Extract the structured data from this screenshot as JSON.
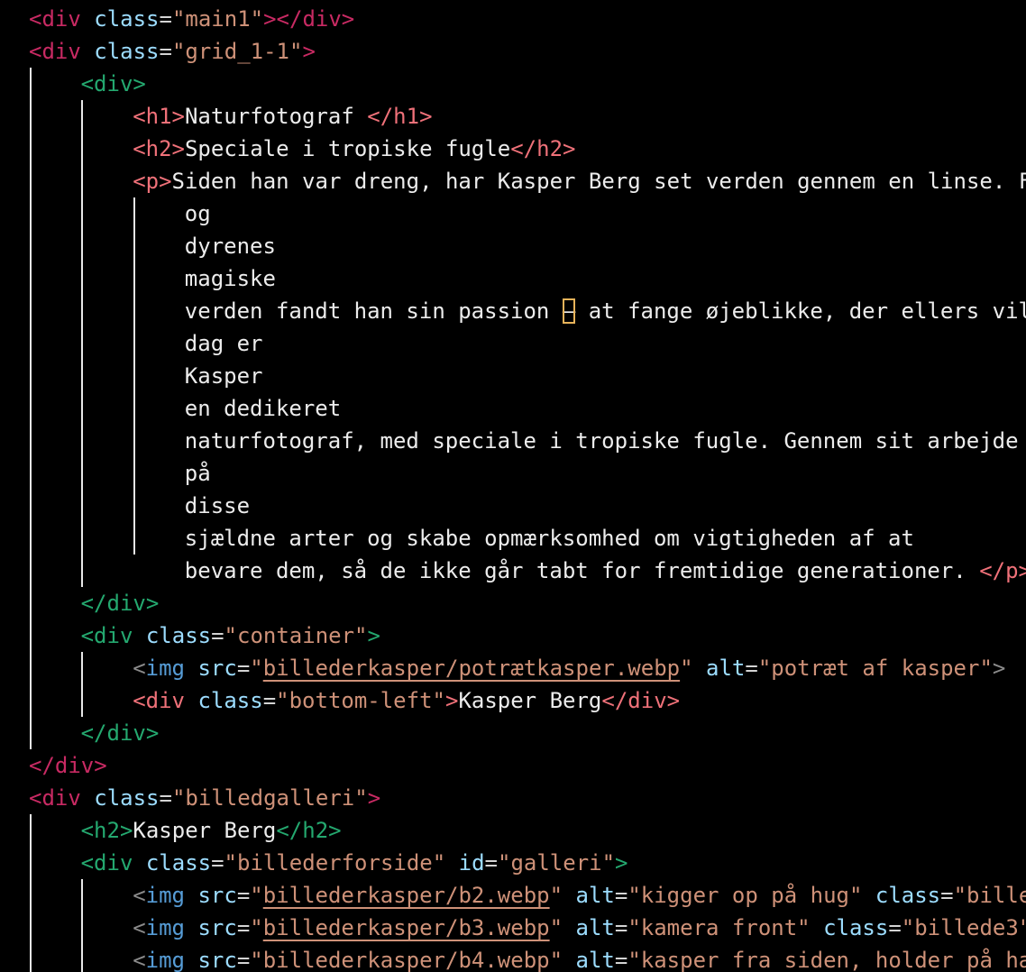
{
  "editor": {
    "language": "html",
    "colors": {
      "tag_depth0": "#c82a63",
      "tag_depth1": "#24a86f",
      "tag_depth2": "#ef7179",
      "attribute": "#9cdcfe",
      "string": "#ce9178",
      "text": "#ececec",
      "bracket_highlight": "#e7b35a"
    },
    "lines": [
      {
        "indent": 0,
        "tokens": [
          [
            "t-d0",
            "<div"
          ],
          [
            "txt",
            " "
          ],
          [
            "attr",
            "class"
          ],
          [
            "eq",
            "="
          ],
          [
            "str",
            "\"main1\""
          ],
          [
            "t-d0",
            "></div>"
          ]
        ]
      },
      {
        "indent": 0,
        "tokens": [
          [
            "t-d0",
            "<div"
          ],
          [
            "txt",
            " "
          ],
          [
            "attr",
            "class"
          ],
          [
            "eq",
            "="
          ],
          [
            "str",
            "\"grid_1-1\""
          ],
          [
            "t-d0",
            ">"
          ]
        ]
      },
      {
        "indent": 1,
        "tokens": [
          [
            "t-d1",
            "<div>"
          ]
        ]
      },
      {
        "indent": 2,
        "tokens": [
          [
            "t-d2",
            "<h1>"
          ],
          [
            "txt",
            "Naturfotograf "
          ],
          [
            "t-d2",
            "</h1>"
          ]
        ]
      },
      {
        "indent": 2,
        "tokens": [
          [
            "t-d2",
            "<h2>"
          ],
          [
            "txt",
            "Speciale i tropiske fugle"
          ],
          [
            "t-d2",
            "</h2>"
          ]
        ]
      },
      {
        "indent": 2,
        "tokens": [
          [
            "t-d2",
            "<p>"
          ],
          [
            "txt",
            "Siden han var dreng, har Kasper Berg set verden gennem en linse. F"
          ]
        ]
      },
      {
        "indent": 3,
        "tokens": [
          [
            "txt",
            "og"
          ]
        ]
      },
      {
        "indent": 3,
        "tokens": [
          [
            "txt",
            "dyrenes"
          ]
        ]
      },
      {
        "indent": 3,
        "tokens": [
          [
            "txt",
            "magiske"
          ]
        ]
      },
      {
        "indent": 3,
        "tokens": [
          [
            "txt",
            "verden fandt han sin passion "
          ],
          [
            "box",
            "–"
          ],
          [
            "txt",
            " at fange øjeblikke, der ellers vil"
          ]
        ]
      },
      {
        "indent": 3,
        "tokens": [
          [
            "txt",
            "dag er"
          ]
        ]
      },
      {
        "indent": 3,
        "tokens": [
          [
            "txt",
            "Kasper"
          ]
        ]
      },
      {
        "indent": 3,
        "tokens": [
          [
            "txt",
            "en dedikeret"
          ]
        ]
      },
      {
        "indent": 3,
        "tokens": [
          [
            "txt",
            "naturfotograf, med speciale i tropiske fugle. Gennem sit arbejde "
          ]
        ]
      },
      {
        "indent": 3,
        "tokens": [
          [
            "txt",
            "på"
          ]
        ]
      },
      {
        "indent": 3,
        "tokens": [
          [
            "txt",
            "disse"
          ]
        ]
      },
      {
        "indent": 3,
        "tokens": [
          [
            "txt",
            "sjældne arter og skabe opmærksomhed om vigtigheden af at"
          ]
        ]
      },
      {
        "indent": 3,
        "tokens": [
          [
            "txt",
            "bevare dem, så de ikke går tabt for fremtidige generationer. "
          ],
          [
            "t-d2",
            "</p>"
          ]
        ]
      },
      {
        "indent": 1,
        "tokens": [
          [
            "t-d1",
            "</div>"
          ]
        ]
      },
      {
        "indent": 1,
        "tokens": [
          [
            "t-d1",
            "<div"
          ],
          [
            "txt",
            " "
          ],
          [
            "attr",
            "class"
          ],
          [
            "eq",
            "="
          ],
          [
            "str",
            "\"container\""
          ],
          [
            "t-d1",
            ">"
          ]
        ]
      },
      {
        "indent": 2,
        "tokens": [
          [
            "t-p",
            "<"
          ],
          [
            "t-img",
            "img"
          ],
          [
            "txt",
            " "
          ],
          [
            "attr",
            "src"
          ],
          [
            "eq",
            "="
          ],
          [
            "str",
            "\""
          ],
          [
            "link",
            "billederkasper/potrætkasper.webp"
          ],
          [
            "str",
            "\""
          ],
          [
            "txt",
            " "
          ],
          [
            "attr",
            "alt"
          ],
          [
            "eq",
            "="
          ],
          [
            "str",
            "\"potræt af kasper\""
          ],
          [
            "t-p",
            ">"
          ]
        ]
      },
      {
        "indent": 2,
        "tokens": [
          [
            "t-d2",
            "<div"
          ],
          [
            "txt",
            " "
          ],
          [
            "attr",
            "class"
          ],
          [
            "eq",
            "="
          ],
          [
            "str",
            "\"bottom-left\""
          ],
          [
            "t-d2",
            ">"
          ],
          [
            "txt",
            "Kasper Berg"
          ],
          [
            "t-d2",
            "</div>"
          ]
        ]
      },
      {
        "indent": 1,
        "tokens": [
          [
            "t-d1",
            "</div>"
          ]
        ]
      },
      {
        "indent": 0,
        "tokens": [
          [
            "t-d0",
            "</div>"
          ]
        ]
      },
      {
        "indent": 0,
        "tokens": [
          [
            "t-d0",
            "<div"
          ],
          [
            "txt",
            " "
          ],
          [
            "attr",
            "class"
          ],
          [
            "eq",
            "="
          ],
          [
            "str",
            "\"billedgalleri\""
          ],
          [
            "t-d0",
            ">"
          ]
        ]
      },
      {
        "indent": 1,
        "tokens": [
          [
            "t-d1",
            "<h2>"
          ],
          [
            "txt",
            "Kasper Berg"
          ],
          [
            "t-d1",
            "</h2>"
          ]
        ]
      },
      {
        "indent": 1,
        "tokens": [
          [
            "t-d1",
            "<div"
          ],
          [
            "txt",
            " "
          ],
          [
            "attr",
            "class"
          ],
          [
            "eq",
            "="
          ],
          [
            "str",
            "\"billederforside\""
          ],
          [
            "txt",
            " "
          ],
          [
            "attr",
            "id"
          ],
          [
            "eq",
            "="
          ],
          [
            "str",
            "\"galleri\""
          ],
          [
            "t-d1",
            ">"
          ]
        ]
      },
      {
        "indent": 2,
        "tokens": [
          [
            "t-p",
            "<"
          ],
          [
            "t-img",
            "img"
          ],
          [
            "txt",
            " "
          ],
          [
            "attr",
            "src"
          ],
          [
            "eq",
            "="
          ],
          [
            "str",
            "\""
          ],
          [
            "link",
            "billederkasper/b2.webp"
          ],
          [
            "str",
            "\""
          ],
          [
            "txt",
            " "
          ],
          [
            "attr",
            "alt"
          ],
          [
            "eq",
            "="
          ],
          [
            "str",
            "\"kigger op på hug\""
          ],
          [
            "txt",
            " "
          ],
          [
            "attr",
            "class"
          ],
          [
            "eq",
            "="
          ],
          [
            "str",
            "\"bille"
          ]
        ]
      },
      {
        "indent": 2,
        "tokens": [
          [
            "t-p",
            "<"
          ],
          [
            "t-img",
            "img"
          ],
          [
            "txt",
            " "
          ],
          [
            "attr",
            "src"
          ],
          [
            "eq",
            "="
          ],
          [
            "str",
            "\""
          ],
          [
            "link",
            "billederkasper/b3.webp"
          ],
          [
            "str",
            "\""
          ],
          [
            "txt",
            " "
          ],
          [
            "attr",
            "alt"
          ],
          [
            "eq",
            "="
          ],
          [
            "str",
            "\"kamera front\""
          ],
          [
            "txt",
            " "
          ],
          [
            "attr",
            "class"
          ],
          [
            "eq",
            "="
          ],
          [
            "str",
            "\"billede3\""
          ]
        ]
      },
      {
        "indent": 2,
        "tokens": [
          [
            "t-p",
            "<"
          ],
          [
            "t-img",
            "img"
          ],
          [
            "txt",
            " "
          ],
          [
            "attr",
            "src"
          ],
          [
            "eq",
            "="
          ],
          [
            "str",
            "\""
          ],
          [
            "link",
            "billederkasper/b4.webp"
          ],
          [
            "str",
            "\""
          ],
          [
            "txt",
            " "
          ],
          [
            "attr",
            "alt"
          ],
          [
            "eq",
            "="
          ],
          [
            "str",
            "\"kasper fra siden, holder på ha"
          ]
        ]
      }
    ]
  }
}
